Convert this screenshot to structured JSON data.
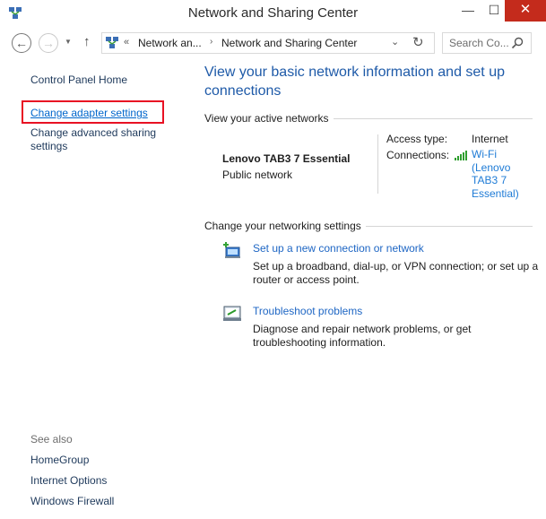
{
  "window": {
    "title": "Network and Sharing Center",
    "minimize_glyph": "—",
    "maximize_glyph": "☐",
    "close_glyph": "✕"
  },
  "navigation": {
    "back_glyph": "←",
    "forward_glyph": "→",
    "recent_glyph": "▼",
    "up_glyph": "↑",
    "address": {
      "overflow_glyph": "«",
      "segments": [
        "Network an...",
        "Network and Sharing Center"
      ],
      "separator_glyph": "›",
      "dropdown_glyph": "⌄",
      "refresh_glyph": "↻"
    },
    "search_placeholder": "Search Co..."
  },
  "sidebar": {
    "items": [
      {
        "label": "Control Panel Home"
      },
      {
        "label": "Change adapter settings",
        "highlighted": true
      },
      {
        "label": "Change advanced sharing settings"
      }
    ],
    "see_also_label": "See also",
    "see_also_items": [
      {
        "label": "HomeGroup"
      },
      {
        "label": "Internet Options"
      },
      {
        "label": "Windows Firewall"
      }
    ]
  },
  "main": {
    "title": "View your basic network information and set up connections",
    "active_networks_header": "View your active networks",
    "network": {
      "name": "Lenovo TAB3 7 Essential",
      "category": "Public network",
      "access_type_label": "Access type:",
      "access_type_value": "Internet",
      "connections_label": "Connections:",
      "connection_link": "Wi-Fi (Lenovo TAB3 7 Essential)"
    },
    "change_settings_header": "Change your networking settings",
    "tasks": [
      {
        "icon": "new-connection-icon",
        "link": "Set up a new connection or network",
        "description": "Set up a broadband, dial-up, or VPN connection; or set up a router or access point."
      },
      {
        "icon": "troubleshoot-icon",
        "link": "Troubleshoot problems",
        "description": "Diagnose and repair network problems, or get troubleshooting information."
      }
    ]
  },
  "colors": {
    "link": "#1e66c4",
    "title": "#1e5aa8",
    "close_button": "#c42b1c",
    "highlight_border": "#e81123",
    "wifi_bars": "#2e9e2e"
  }
}
